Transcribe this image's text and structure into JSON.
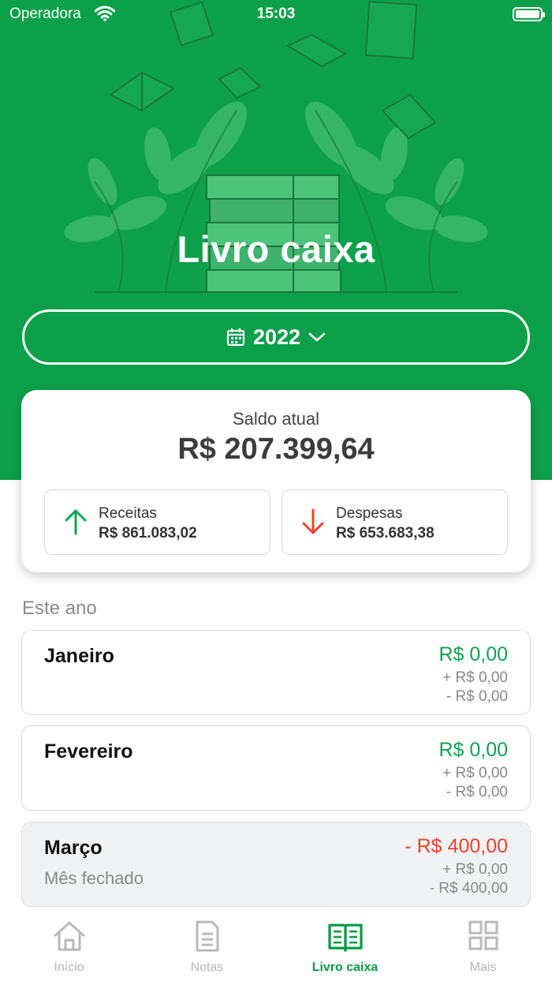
{
  "status_bar": {
    "carrier": "Operadora",
    "time": "15:03"
  },
  "header": {
    "title": "Livro caixa",
    "year_selector": {
      "value": "2022",
      "icon": "calendar-icon",
      "chevron": "chevron-down-icon"
    }
  },
  "balance": {
    "label": "Saldo atual",
    "value": "R$ 207.399,64",
    "receitas": {
      "label": "Receitas",
      "value": "R$ 861.083,02",
      "icon": "arrow-up-icon",
      "color": "#12a150"
    },
    "despesas": {
      "label": "Despesas",
      "value": "R$ 653.683,38",
      "icon": "arrow-down-icon",
      "color": "#e8442c"
    }
  },
  "section": {
    "title": "Este ano"
  },
  "months": [
    {
      "name": "Janeiro",
      "status": "",
      "total": "R$ 0,00",
      "income": "+ R$ 0,00",
      "expense": "- R$ 0,00"
    },
    {
      "name": "Fevereiro",
      "status": "",
      "total": "R$ 0,00",
      "income": "+ R$ 0,00",
      "expense": "- R$ 0,00"
    },
    {
      "name": "Março",
      "status": "Mês fechado",
      "total": "- R$ 400,00",
      "income": "+ R$ 0,00",
      "expense": "- R$ 400,00"
    }
  ],
  "tabs": [
    {
      "label": "Início",
      "icon": "home-icon",
      "active": false
    },
    {
      "label": "Notas",
      "icon": "document-icon",
      "active": false
    },
    {
      "label": "Livro caixa",
      "icon": "open-book-icon",
      "active": true
    },
    {
      "label": "Mais",
      "icon": "grid-icon",
      "active": false
    }
  ],
  "colors": {
    "brand_green": "#0da04a",
    "positive": "#12a150",
    "negative": "#e8442c",
    "muted": "#888888"
  }
}
